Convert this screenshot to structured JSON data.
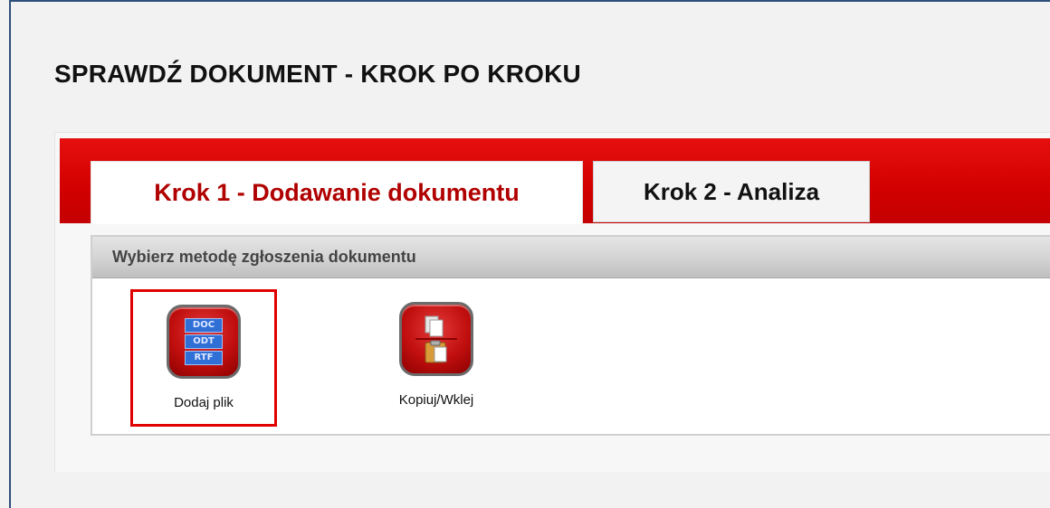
{
  "page": {
    "title": "SPRAWDŹ DOKUMENT - KROK PO KROKU"
  },
  "tabs": [
    {
      "label": "Krok 1 - Dodawanie dokumentu",
      "active": true
    },
    {
      "label": "Krok 2 - Analiza",
      "active": false
    }
  ],
  "section": {
    "header": "Wybierz metodę zgłoszenia dokumentu"
  },
  "methods": [
    {
      "label": "Dodaj plik",
      "icon": "document-formats-icon",
      "selected": true,
      "formats": [
        "DOC",
        "ODT",
        "RTF"
      ]
    },
    {
      "label": "Kopiuj/Wklej",
      "icon": "copy-paste-icon",
      "selected": false
    }
  ],
  "colors": {
    "brand_red": "#d20000",
    "active_tab_text": "#b00000",
    "selection_border": "#e00000"
  }
}
